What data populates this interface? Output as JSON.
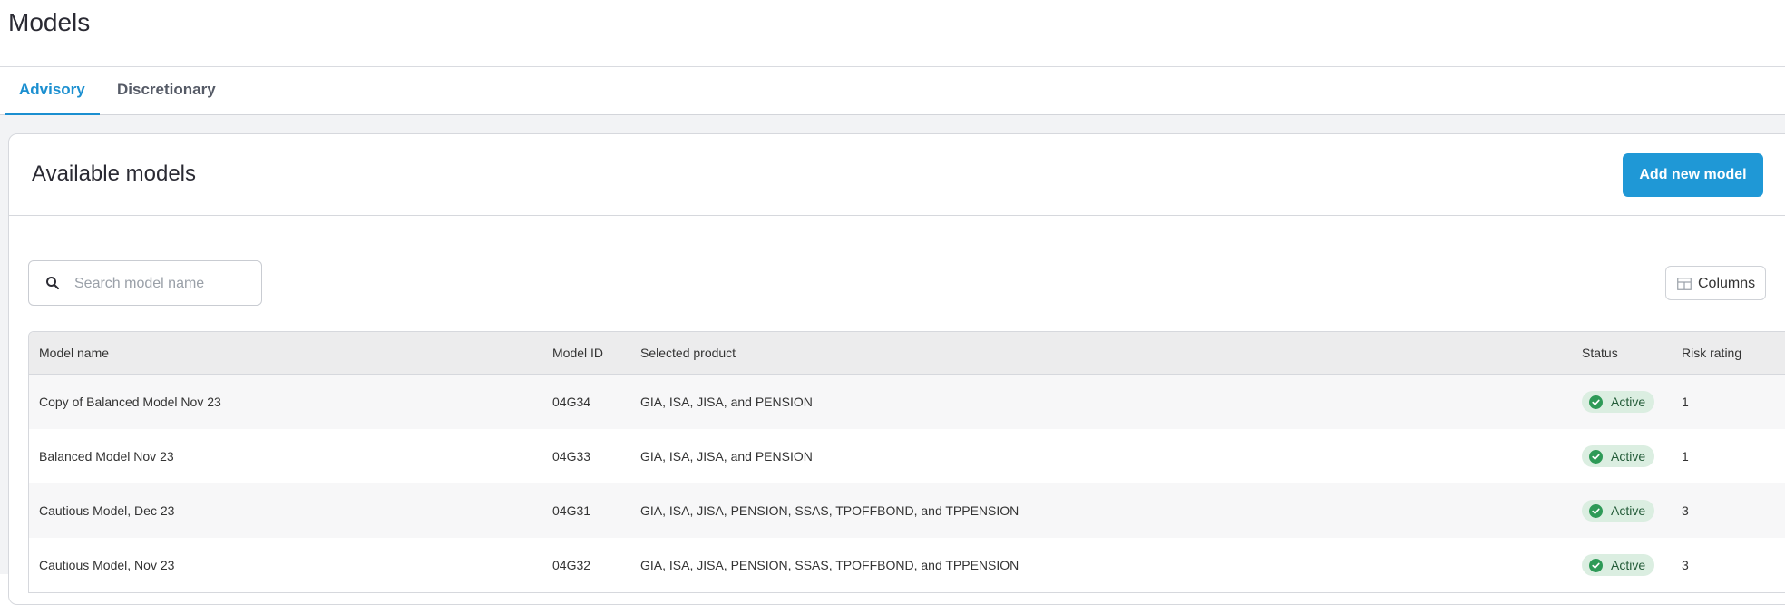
{
  "page": {
    "title": "Models"
  },
  "tabs": [
    {
      "label": "Advisory",
      "active": true
    },
    {
      "label": "Discretionary",
      "active": false
    }
  ],
  "card": {
    "title": "Available models",
    "add_button_label": "Add new model"
  },
  "search": {
    "placeholder": "Search model name",
    "value": ""
  },
  "columns_button": {
    "label": "Columns",
    "icon": "table-columns-icon"
  },
  "table": {
    "headers": [
      "Model name",
      "Model ID",
      "Selected product",
      "Status",
      "Risk rating"
    ],
    "rows": [
      {
        "name": "Copy of Balanced Model Nov 23",
        "id": "04G34",
        "product": "GIA, ISA, JISA, and PENSION",
        "status": "Active",
        "risk": "1"
      },
      {
        "name": "Balanced Model Nov 23",
        "id": "04G33",
        "product": "GIA, ISA, JISA, and PENSION",
        "status": "Active",
        "risk": "1"
      },
      {
        "name": "Cautious Model, Dec 23",
        "id": "04G31",
        "product": "GIA, ISA, JISA, PENSION, SSAS, TPOFFBOND, and TPPENSION",
        "status": "Active",
        "risk": "3"
      },
      {
        "name": "Cautious Model, Nov 23",
        "id": "04G32",
        "product": "GIA, ISA, JISA, PENSION, SSAS, TPOFFBOND, and TPPENSION",
        "status": "Active",
        "risk": "3"
      }
    ]
  },
  "colors": {
    "accent": "#1f98d6",
    "status_active_bg": "#dbeee1",
    "status_active_icon": "#2e9a57"
  }
}
